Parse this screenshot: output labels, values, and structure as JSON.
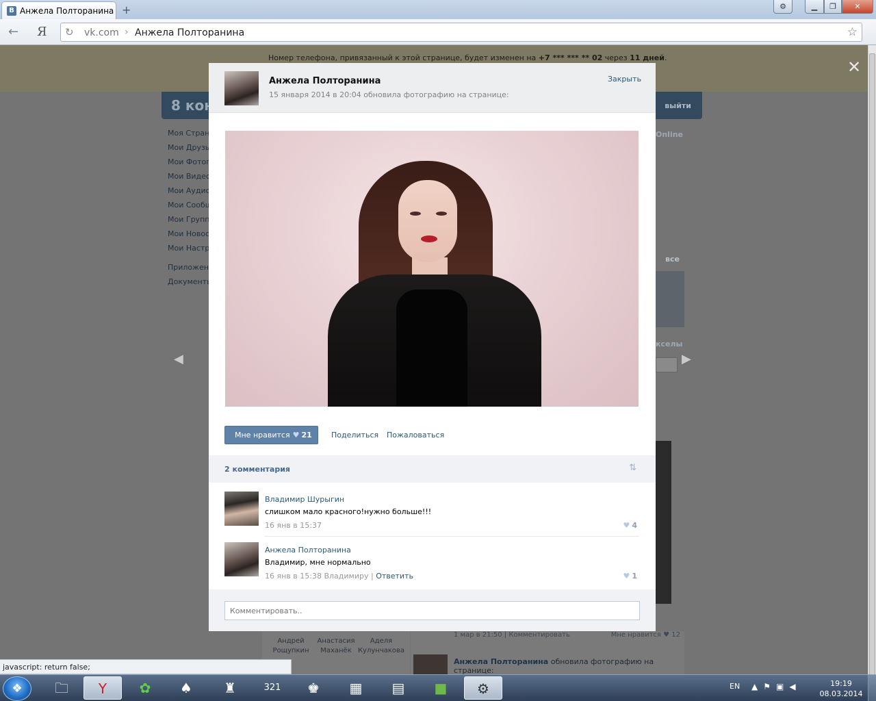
{
  "browser": {
    "tab_title": "Анжела Полторанина",
    "tab_favicon": "В",
    "new_tab": "+",
    "toolbar_logo": "Я",
    "url_host": "vk.com",
    "url_separator": "›",
    "url_title": "Анжела Полторанина",
    "status_text": "javascript: return false;"
  },
  "page": {
    "notice_prefix": "Номер телефона, привязанный к этой странице, будет изменен на ",
    "notice_phone": "+7 *** *** ** 02",
    "notice_middle": " через ",
    "notice_days": "11 дней",
    "notice_end": ".",
    "logo_text": "8 кон",
    "exit_label": "выйти",
    "menu": [
      "Моя Страни",
      "Мои Друзья",
      "Мои Фотогр",
      "Мои Видеоз",
      "Мои Аудиоз",
      "Мои Сообще",
      "Мои Группы",
      "Мои Новост",
      "Мои Настро",
      "Приложени",
      "Документы"
    ],
    "online_label": "Online",
    "all_label": "все",
    "right_label": "кселы",
    "friends": [
      {
        "first": "Андрей",
        "last": "Рощупкин"
      },
      {
        "first": "Анастасия",
        "last": "Маханёк"
      },
      {
        "first": "Аделя",
        "last": "Кулунчакова"
      }
    ],
    "wall_meta": "1 мар в 21:50 | Комментировать",
    "wall_likes": "Мне нравится ♥ 12",
    "wall_author": "Анжела Полторанина",
    "wall_action": " обновила фотографию на",
    "wall_action_tail": "странице:"
  },
  "modal": {
    "author": "Анжела Полторанина",
    "subtitle": "15 января 2014 в 20:04 обновила фотографию на странице:",
    "close_label": "Закрыть",
    "like_label": "Мне нравится",
    "like_count": "21",
    "share_label": "Поделиться",
    "report_label": "Пожаловаться",
    "comments_count_label": "2 комментария",
    "comments": [
      {
        "author": "Владимир Шурыгин",
        "text": "слишком мало красного!нужно больше!!!",
        "date": "16 янв в 15:37",
        "likes": "4"
      },
      {
        "author": "Анжела Полторанина",
        "text": "Владимир, мне нормально",
        "date": "16 янв в 15:38 Владимиру",
        "reply_sep": " | ",
        "reply_label": "Ответить",
        "likes": "1"
      }
    ],
    "comment_placeholder": "Комментировать.."
  },
  "taskbar": {
    "lang": "EN",
    "time": "19:19",
    "date": "08.03.2014"
  },
  "icons": {
    "back": "back-arrow-icon",
    "reload": "reload-icon",
    "star": "bookmark-star-icon",
    "heart": "heart-icon",
    "sort": "sort-icon",
    "close": "close-icon"
  },
  "colors": {
    "vk_link": "#2b587a",
    "vk_button": "#5e82a8",
    "vk_header": "#33495d",
    "overlay": "#747474"
  }
}
